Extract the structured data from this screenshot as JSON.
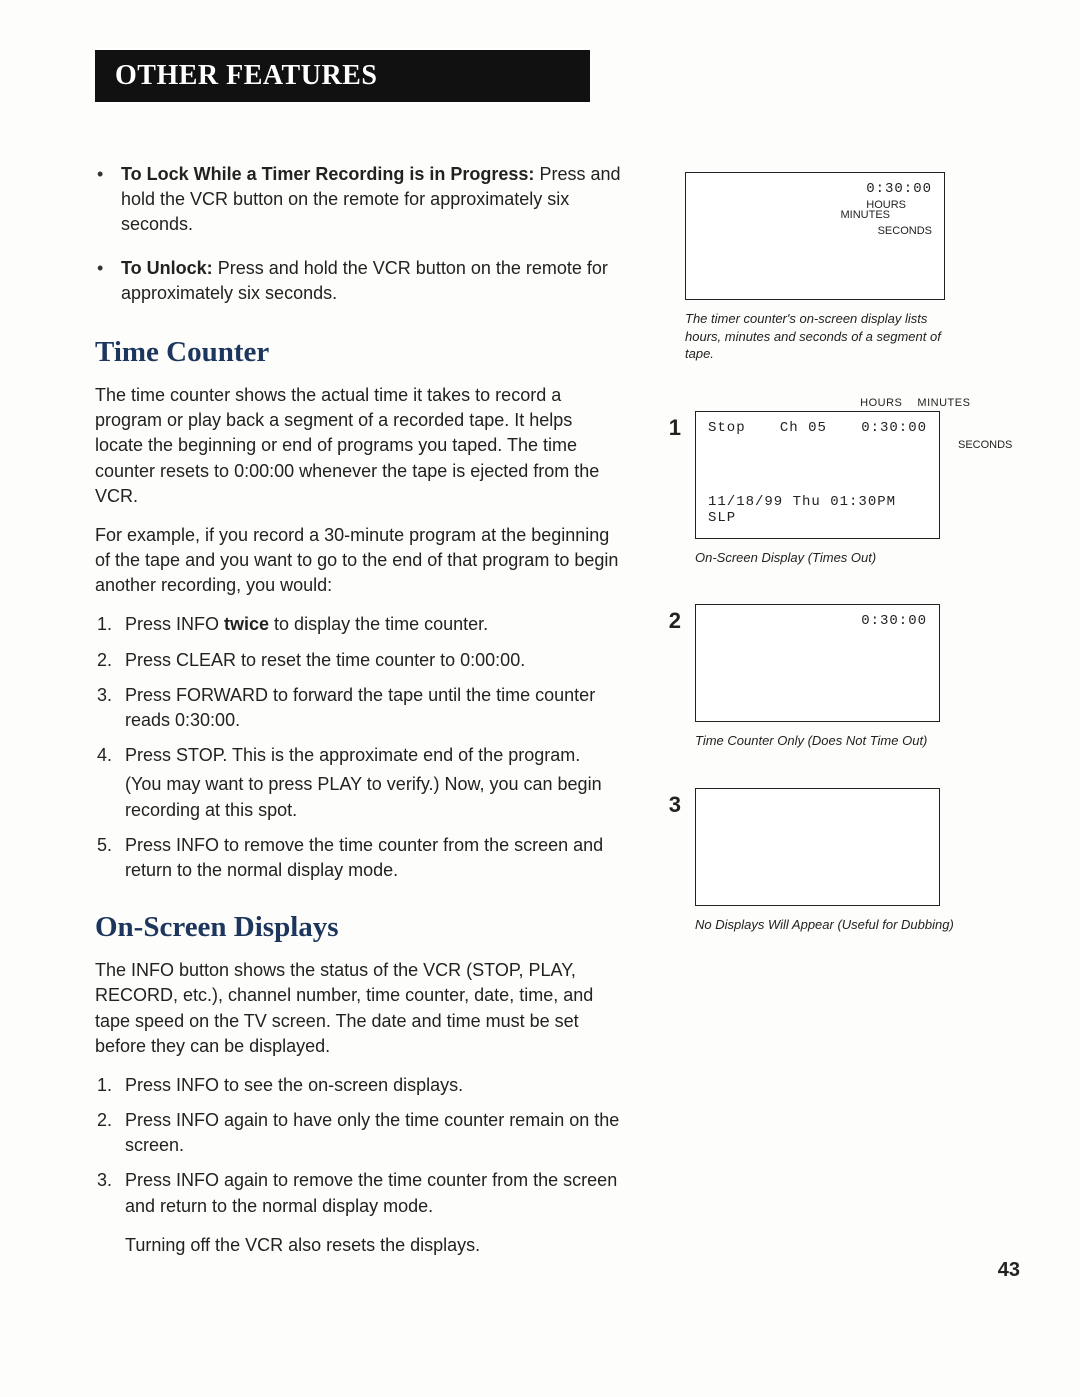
{
  "banner": "OTHER FEATURES",
  "bullets": [
    {
      "title": "To Lock While a Timer Recording is in Progress:",
      "text": "Press and hold the VCR button on the remote for approximately six seconds."
    },
    {
      "title": "To Unlock:",
      "text": "Press and hold the VCR button on the remote for approximately six seconds."
    }
  ],
  "sections": {
    "time_counter": {
      "heading": "Time Counter",
      "p1": "The time counter shows the actual time it takes to record a program or play back a segment of a recorded tape. It helps locate the beginning or end of programs you taped. The time counter resets to 0:00:00 whenever the tape is ejected from the VCR.",
      "p2": "For example, if you record a 30-minute program at the beginning of the tape and you want to go to the end of that program to begin another recording, you would:",
      "steps": [
        {
          "text_a": "Press INFO ",
          "bold": "twice",
          "text_b": " to display the time counter."
        },
        {
          "text_a": "Press CLEAR to reset the time counter to 0:00:00.",
          "bold": "",
          "text_b": ""
        },
        {
          "text_a": "Press FORWARD to forward the tape until the time counter reads 0:30:00.",
          "bold": "",
          "text_b": ""
        },
        {
          "text_a": "Press STOP. This is the approximate end of the program.",
          "bold": "",
          "text_b": "",
          "sub": "(You may want to press PLAY to verify.) Now, you can begin recording at this spot."
        },
        {
          "text_a": "Press INFO to remove the time counter from the screen and return to the normal display mode.",
          "bold": "",
          "text_b": ""
        }
      ]
    },
    "osd": {
      "heading": "On-Screen Displays",
      "p1": "The INFO button shows the status of the VCR (STOP, PLAY, RECORD, etc.), channel number, time counter, date, time, and tape speed on the TV screen. The date and time must be set before they can be displayed.",
      "steps": [
        "Press INFO to see the on-screen displays.",
        "Press INFO again to have only the time counter remain on the screen.",
        "Press INFO again to remove the time counter from the screen and return to the normal display mode."
      ],
      "tail": "Turning off the VCR also resets the displays."
    }
  },
  "figures": {
    "top": {
      "time": "0:30:00",
      "labels": {
        "hours": "HOURS",
        "minutes": "MINUTES",
        "seconds": "SECONDS"
      },
      "caption": "The timer counter's on-screen display lists hours, minutes and seconds of a segment of tape."
    },
    "fig1": {
      "num": "1",
      "labels": {
        "hours": "HOURS",
        "minutes": "MINUTES",
        "seconds": "SECONDS"
      },
      "row1_left": "Stop",
      "row1_mid": "Ch 05",
      "row1_right": "0:30:00",
      "row2": "11/18/99 Thu 01:30PM SLP",
      "caption": "On-Screen Display (Times Out)"
    },
    "fig2": {
      "num": "2",
      "time": "0:30:00",
      "caption": "Time Counter Only (Does Not Time Out)"
    },
    "fig3": {
      "num": "3",
      "caption": "No Displays Will Appear (Useful for Dubbing)"
    }
  },
  "page_number": "43"
}
